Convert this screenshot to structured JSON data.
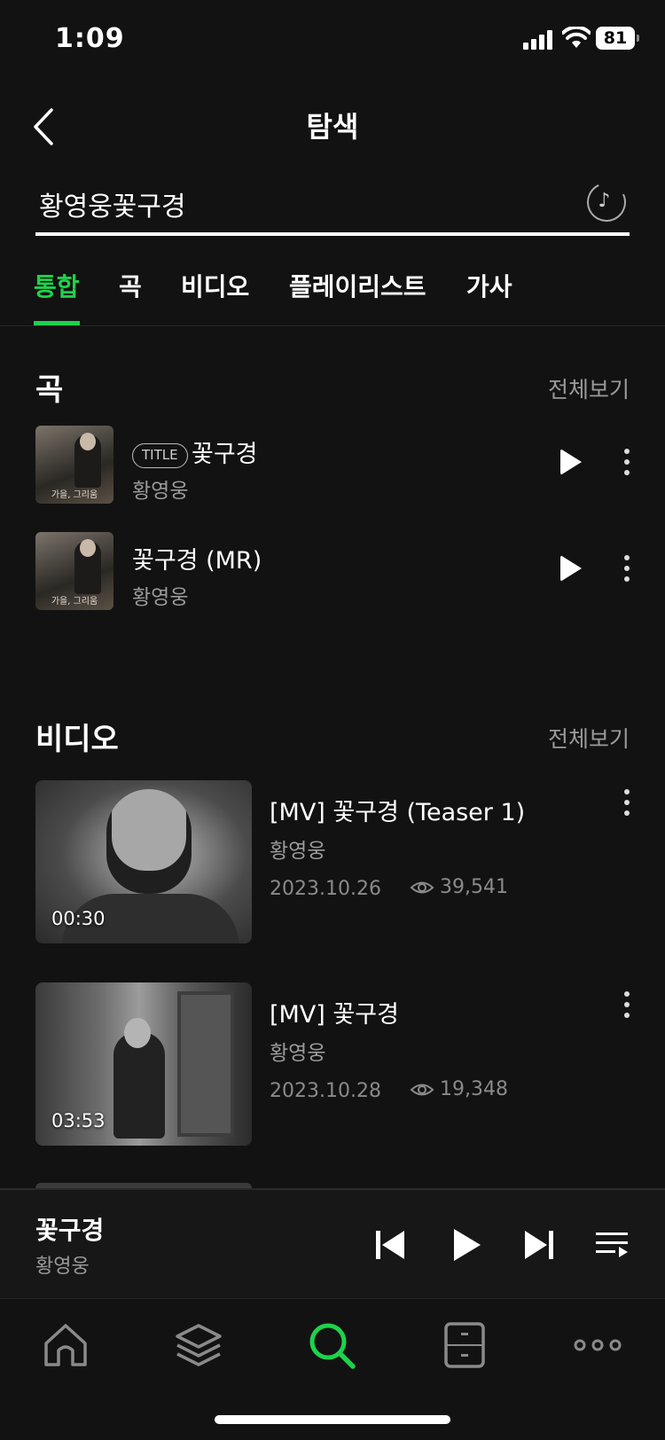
{
  "status_bar": {
    "time": "1:09",
    "battery": "81"
  },
  "header": {
    "title": "탐색"
  },
  "search": {
    "value": "황영웅꽃구경"
  },
  "tabs": [
    {
      "label": "통합",
      "active": true
    },
    {
      "label": "곡",
      "active": false
    },
    {
      "label": "비디오",
      "active": false
    },
    {
      "label": "플레이리스트",
      "active": false
    },
    {
      "label": "가사",
      "active": false
    }
  ],
  "songs_section": {
    "title": "곡",
    "see_all": "전체보기",
    "items": [
      {
        "badge": "TITLE",
        "title": "꽃구경",
        "artist": "황영웅",
        "art_caption": "가을, 그리움"
      },
      {
        "badge": "",
        "title": "꽃구경 (MR)",
        "artist": "황영웅",
        "art_caption": "가을, 그리움"
      }
    ]
  },
  "videos_section": {
    "title": "비디오",
    "see_all": "전체보기",
    "items": [
      {
        "title": "[MV] 꽃구경 (Teaser 1)",
        "artist": "황영웅",
        "date": "2023.10.26",
        "views": "39,541",
        "duration": "00:30"
      },
      {
        "title": "[MV] 꽃구경",
        "artist": "황영웅",
        "date": "2023.10.28",
        "views": "19,348",
        "duration": "03:53"
      }
    ]
  },
  "mini_player": {
    "title": "꽃구경",
    "artist": "황영웅"
  },
  "colors": {
    "accent": "#1ed24b",
    "background": "#121212",
    "secondary_text": "#9a9a9a"
  },
  "bottom_nav": [
    {
      "icon": "home-icon"
    },
    {
      "icon": "layers-icon"
    },
    {
      "icon": "search-icon",
      "active": true
    },
    {
      "icon": "library-icon"
    },
    {
      "icon": "more-horizontal-icon"
    }
  ]
}
